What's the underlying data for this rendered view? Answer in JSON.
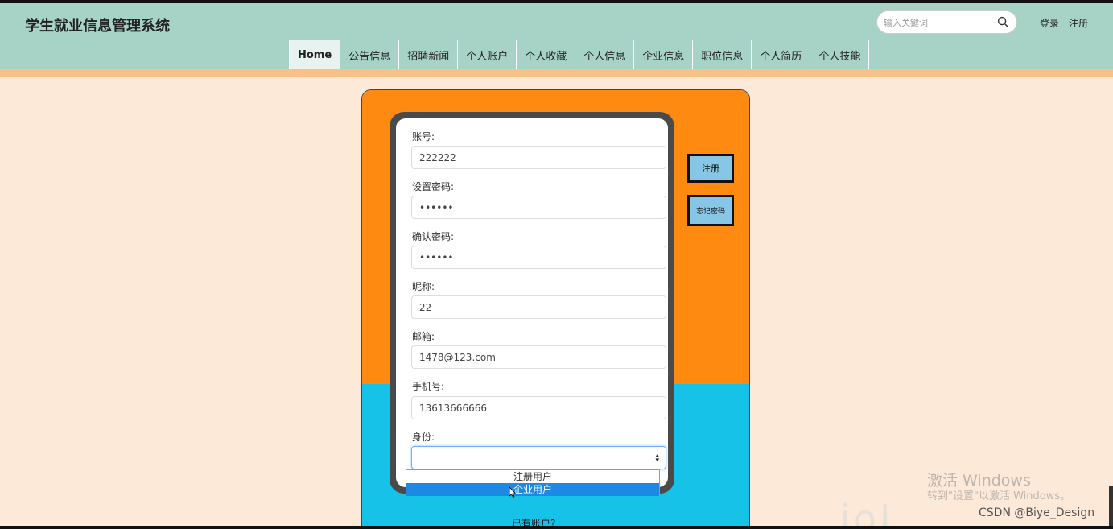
{
  "header": {
    "site_title": "学生就业信息管理系统",
    "search_placeholder": "输入关键词",
    "login_label": "登录",
    "register_label": "注册"
  },
  "nav": {
    "items": [
      "Home",
      "公告信息",
      "招聘新闻",
      "个人账户",
      "个人收藏",
      "个人信息",
      "企业信息",
      "职位信息",
      "个人简历",
      "个人技能"
    ]
  },
  "form": {
    "account_label": "账号:",
    "account_value": "222222",
    "password_label": "设置密码:",
    "password_value": "••••••",
    "confirm_label": "确认密码:",
    "confirm_value": "••••••",
    "nickname_label": "昵称:",
    "nickname_value": "22",
    "email_label": "邮箱:",
    "email_value": "1478@123.com",
    "phone_label": "手机号:",
    "phone_value": "13613666666",
    "identity_label": "身份:",
    "identity_value": "",
    "identity_options": [
      "注册用户",
      "企业用户"
    ],
    "highlighted_option": "企业用户"
  },
  "side_buttons": {
    "register": "注册",
    "forgot": "忘记密码"
  },
  "footer": {
    "have_account": "已有账户?"
  },
  "overlay": {
    "activate_title": "激活 Windows",
    "activate_sub": "转到\"设置\"以激活 Windows。",
    "csdn": "CSDN @Biye_Design"
  },
  "colors": {
    "header_bg": "#a7d3c6",
    "page_bg": "#fde9d8",
    "card_orange": "#ff8a12",
    "card_blue": "#16c2e8",
    "button_blue": "#88c6e6",
    "option_highlight": "#1e88e5"
  }
}
